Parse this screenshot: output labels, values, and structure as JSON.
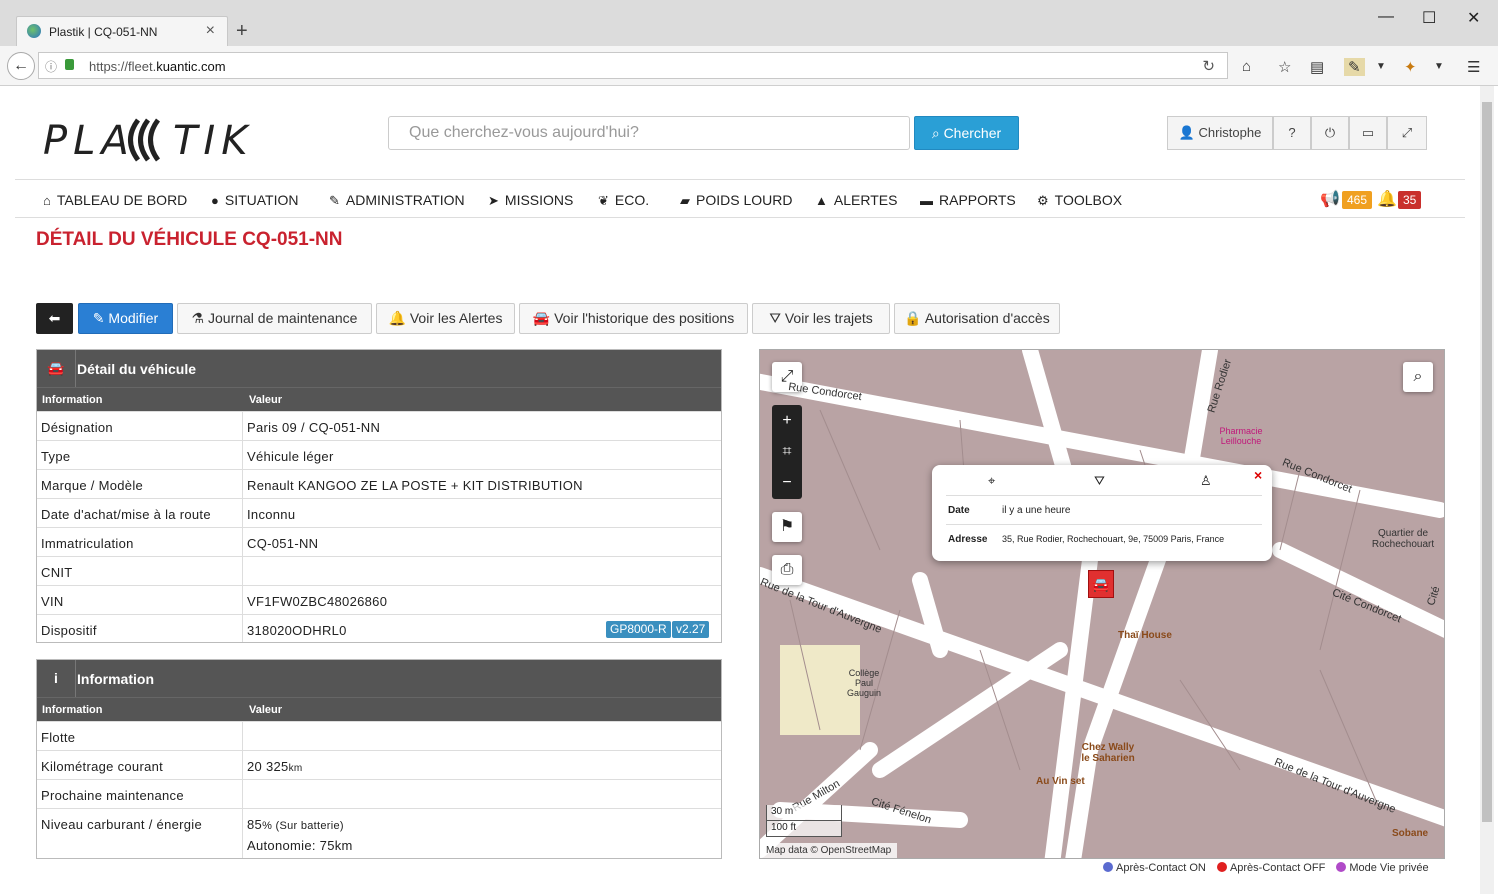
{
  "browser": {
    "tab_title": "Plastik | CQ-051-NN",
    "url_prefix": "https://fleet.",
    "url_domain": "kuantic.com"
  },
  "header": {
    "logo": "PLA  TIK",
    "search_placeholder": "Que cherchez-vous aujourd'hui?",
    "search_button": "Chercher",
    "user": "Christophe"
  },
  "nav": {
    "items": [
      "TABLEAU DE BORD",
      "SITUATION",
      "ADMINISTRATION",
      "MISSIONS",
      "ECO.",
      "POIDS LOURD",
      "ALERTES",
      "RAPPORTS",
      "TOOLBOX"
    ],
    "badge_orange": "465",
    "badge_red": "35"
  },
  "page_title": "DÉTAIL DU VÉHICULE CQ-051-NN",
  "actions": [
    "Modifier",
    "Journal de maintenance",
    "Voir les Alertes",
    "Voir l'historique des positions",
    "Voir les trajets",
    "Autorisation d'accès"
  ],
  "vehicle_panel": {
    "title": "Détail du véhicule",
    "col_info": "Information",
    "col_value": "Valeur",
    "rows": [
      {
        "k": "Désignation",
        "v": "Paris 09 / CQ-051-NN"
      },
      {
        "k": "Type",
        "v": "Véhicule léger"
      },
      {
        "k": "Marque / Modèle",
        "v": "Renault KANGOO ZE LA POSTE + KIT DISTRIBUTION"
      },
      {
        "k": "Date d'achat/mise à la route",
        "v": "Inconnu"
      },
      {
        "k": "Immatriculation",
        "v": "CQ-051-NN"
      },
      {
        "k": "CNIT",
        "v": ""
      },
      {
        "k": "VIN",
        "v": "VF1FW0ZBC48026860"
      },
      {
        "k": "Dispositif",
        "v": "318020ODHRL0"
      }
    ],
    "tag1": "GP8000-R",
    "tag2": "v2.27"
  },
  "info_panel": {
    "title": "Information",
    "col_info": "Information",
    "col_value": "Valeur",
    "rows": [
      {
        "k": "Flotte",
        "v": ""
      },
      {
        "k": "Kilométrage courant",
        "v": "20 325",
        "unit": "km"
      },
      {
        "k": "Prochaine maintenance",
        "v": ""
      },
      {
        "k": "Niveau carburant / énergie",
        "v": "85",
        "unit": "% (Sur batterie)",
        "v2": "Autonomie: 75km"
      }
    ]
  },
  "map": {
    "popup": {
      "date_label": "Date",
      "date_value": "il y a une heure",
      "addr_label": "Adresse",
      "addr_value": "35, Rue Rodier, Rochechouart, 9e, 75009 Paris, France"
    },
    "streets": [
      "Rue Condorcet",
      "Rue Rodier",
      "Rue Condorcet",
      "Cité Condorcet",
      "Rue de la Tour d'Auvergne",
      "Rue de la Tour d'Auvergne",
      "Cité Fénelon",
      "Rue Milton",
      "Quartier de Rochechouart",
      "Collège Paul Gauguin",
      "Pharmacie Leillouche",
      "Cité"
    ],
    "pois": [
      "Thaï House",
      "Chez Wally le Saharien",
      "Au Vin set",
      "Sobane"
    ],
    "scale_m": "30 m",
    "scale_ft": "100 ft",
    "attribution": "Map data © OpenStreetMap"
  },
  "legend": [
    {
      "label": "Après-Contact ON",
      "color": "#5b6bd0"
    },
    {
      "label": "Après-Contact OFF",
      "color": "#e02020"
    },
    {
      "label": "Mode Vie privée",
      "color": "#b04ac8"
    }
  ]
}
